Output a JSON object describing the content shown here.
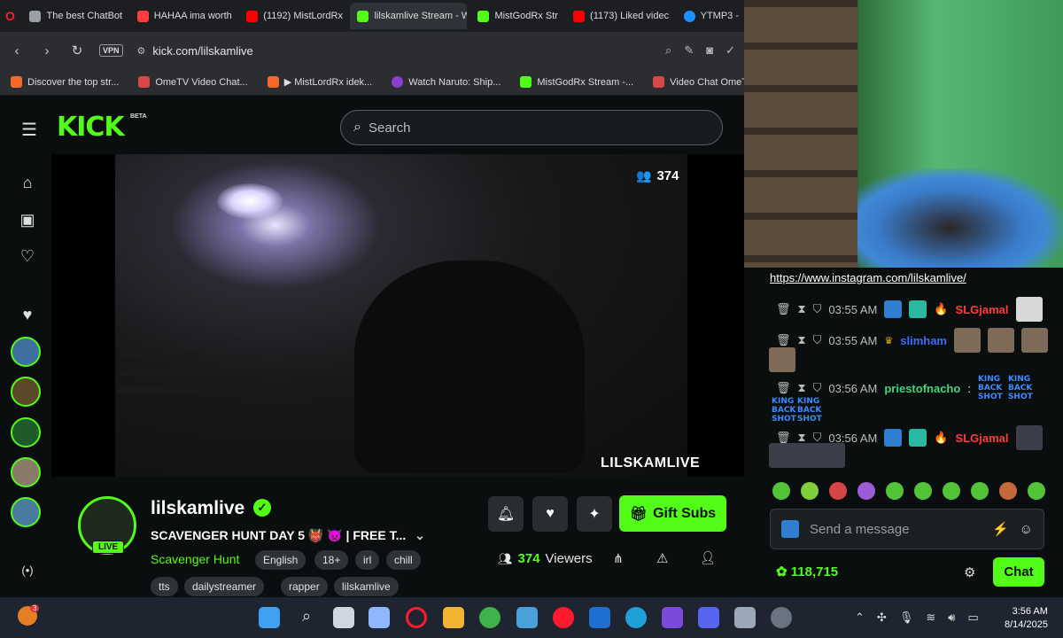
{
  "browser": {
    "tabs": [
      {
        "label": "The best ChatBot",
        "color": "#9aa0a6"
      },
      {
        "label": "HAHAA ima worth",
        "color": "#ff3d3d"
      },
      {
        "label": "(1192) MistLordRx",
        "color": "#ff0000"
      },
      {
        "label": "lilskamlive Stream - W",
        "color": "#53fc18"
      },
      {
        "label": "MistGodRx Str",
        "color": "#53fc18"
      },
      {
        "label": "(1173) Liked videc",
        "color": "#ff0000"
      },
      {
        "label": "YTMP3 -",
        "color": "#1e90ff"
      }
    ],
    "vpn_label": "VPN",
    "url": "kick.com/lilskamlive",
    "bookmarks": [
      {
        "label": "Discover the top str...",
        "color": "#f56a2b"
      },
      {
        "label": "OmeTV Video Chat...",
        "color": "#d94848"
      },
      {
        "label": "▶ MistLordRx idek...",
        "color": "#f56a2b"
      },
      {
        "label": "Watch Naruto: Ship...",
        "color": "#8b3fd1"
      },
      {
        "label": "MistGodRx Stream -...",
        "color": "#53fc18"
      },
      {
        "label": "Video Chat OmeTV...",
        "color": "#d94848"
      }
    ]
  },
  "kick": {
    "logo": "KICK",
    "beta": "BETA",
    "search_placeholder": "Search",
    "viewer_overlay": "374",
    "watermark": "LILSKAMLIVE",
    "channel": {
      "name": "lilskamlive",
      "live_label": "LIVE",
      "title": "SCAVENGER HUNT DAY 5 👹 👿 | FREE T...",
      "category": "Scavenger Hunt",
      "tags": [
        "English",
        "18+",
        "irl",
        "chill",
        "tts",
        "dailystreamer",
        "rapper",
        "lilskamlive"
      ],
      "gift_label": "Gift Subs",
      "viewers_count": "374",
      "viewers_label": "Viewers"
    },
    "accent": "#53fc18"
  },
  "chat": {
    "link": "https://www.instagram.com/lilskamlive/",
    "messages": [
      {
        "time": "03:55 AM",
        "user": "SLGjamal",
        "user_color": "#ff3b3b"
      },
      {
        "time": "03:55 AM",
        "user": "slimham",
        "user_color": "#3b6dff"
      },
      {
        "time": "03:56 AM",
        "user": "priestofnacho",
        "user_color": "#3fd77a"
      },
      {
        "time": "03:56 AM",
        "user": "SLGjamal",
        "user_color": "#ff3b3b"
      }
    ],
    "text_emote": "KING BACK SHOT",
    "input_placeholder": "Send a message",
    "points": "118,715",
    "chat_button": "Chat"
  },
  "taskbar": {
    "time": "3:56 AM",
    "date": "8/14/2025",
    "notification_count": "3"
  }
}
